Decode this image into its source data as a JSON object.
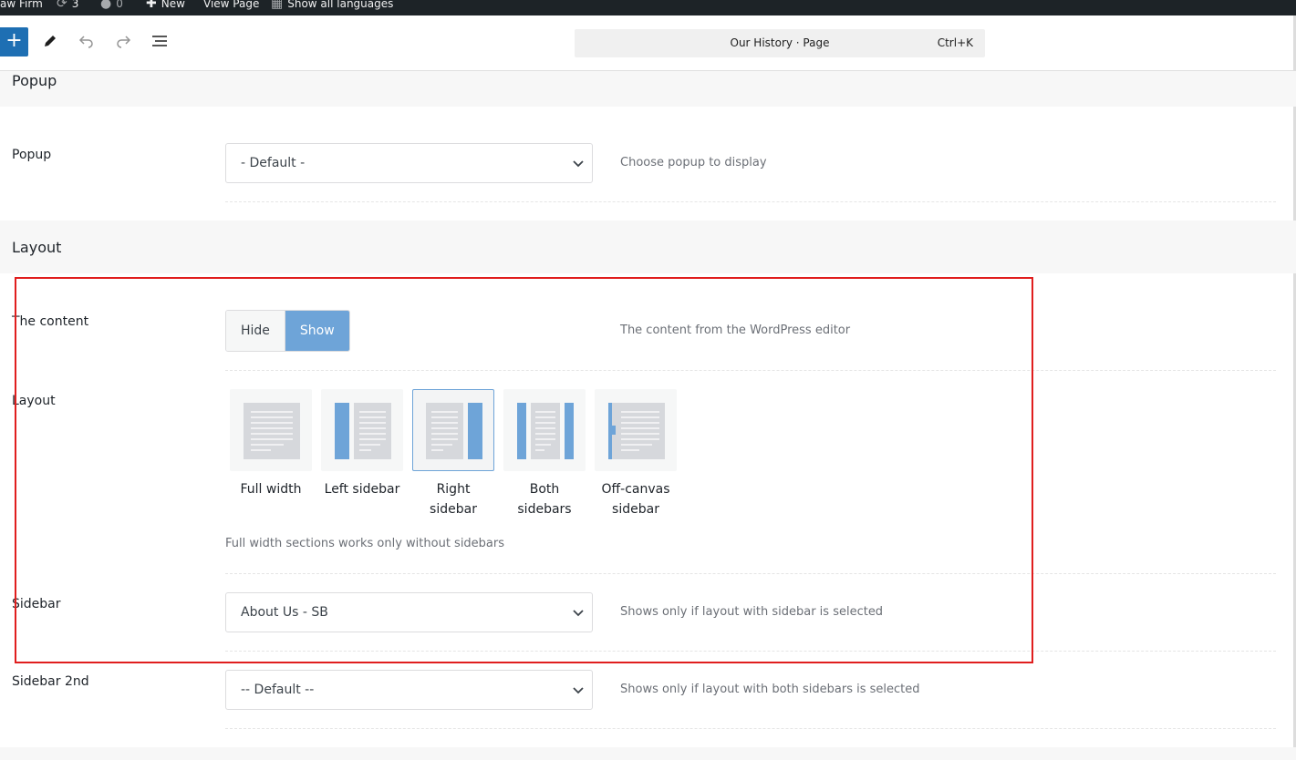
{
  "admin_bar": {
    "site": "aw Firm",
    "updates": "3",
    "comments": "0",
    "new": "New",
    "view": "View Page",
    "languages": "Show all languages"
  },
  "toolbar": {
    "add_label": "+",
    "document_title": "Our History · Page",
    "shortcut": "Ctrl+K"
  },
  "sections": {
    "popup_heading": "Popup",
    "layout_heading": "Layout"
  },
  "popup": {
    "label": "Popup",
    "value": "- Default -",
    "desc": "Choose popup to display"
  },
  "content_toggle": {
    "label": "The content",
    "hide": "Hide",
    "show": "Show",
    "selected": "Show",
    "desc": "The content from the WordPress editor"
  },
  "layout": {
    "label": "Layout",
    "selected": "Right sidebar",
    "options": [
      {
        "line1": "Full width",
        "line2": ""
      },
      {
        "line1": "Left sidebar",
        "line2": ""
      },
      {
        "line1": "Right",
        "line2": "sidebar"
      },
      {
        "line1": "Both",
        "line2": "sidebars"
      },
      {
        "line1": "Off-canvas",
        "line2": "sidebar"
      }
    ],
    "note": "Full width sections works only without sidebars"
  },
  "sidebar": {
    "label": "Sidebar",
    "value": "About Us - SB",
    "desc": "Shows only if layout with sidebar is selected"
  },
  "sidebar2": {
    "label": "Sidebar 2nd",
    "value": "-- Default --",
    "desc": "Shows only if layout with both sidebars is selected"
  },
  "colors": {
    "accent": "#1e6fb3",
    "toggle_on": "#6ea4d8",
    "highlight": "#e01e1e"
  }
}
